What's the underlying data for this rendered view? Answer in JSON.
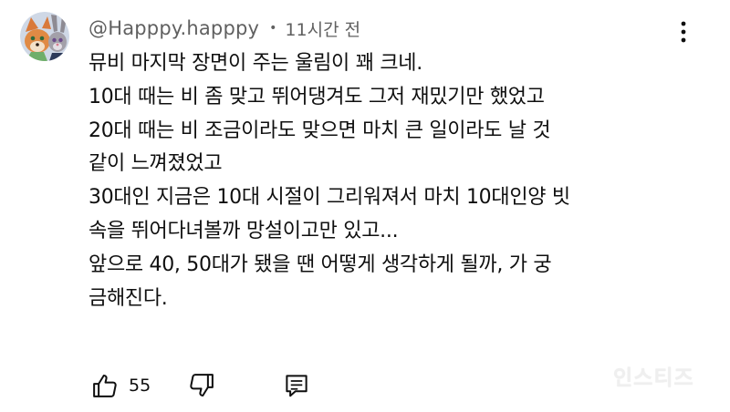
{
  "comment": {
    "author": "@Happpy.happpy",
    "separator": "•",
    "time": "11시간 전",
    "lines": [
      "뮤비 마지막 장면이 주는 울림이 꽤 크네.",
      "10대 때는 비 좀 맞고 뛰어댕겨도 그저 재밌기만 했었고",
      "20대 때는 비 조금이라도 맞으면 마치 큰 일이라도 날 것",
      "같이 느껴졌었고",
      "30대인 지금은 10대 시절이 그리워져서 마치 10대인양 빗",
      "속을 뛰어다녀볼까 망설이고만 있고...",
      "앞으로 40, 50대가 됐을 땐 어떻게 생각하게 될까, 가 궁",
      "금해진다."
    ]
  },
  "actions": {
    "like_count": "55"
  },
  "icons": {
    "avatar": "avatar-icon",
    "more": "more-vertical-icon",
    "like": "thumbs-up-icon",
    "dislike": "thumbs-down-icon",
    "reply": "reply-comment-icon"
  },
  "watermark": "인스티즈",
  "colors": {
    "text": "#0f0f0f",
    "meta": "#606060",
    "background": "#ffffff",
    "watermark": "#efefef"
  }
}
